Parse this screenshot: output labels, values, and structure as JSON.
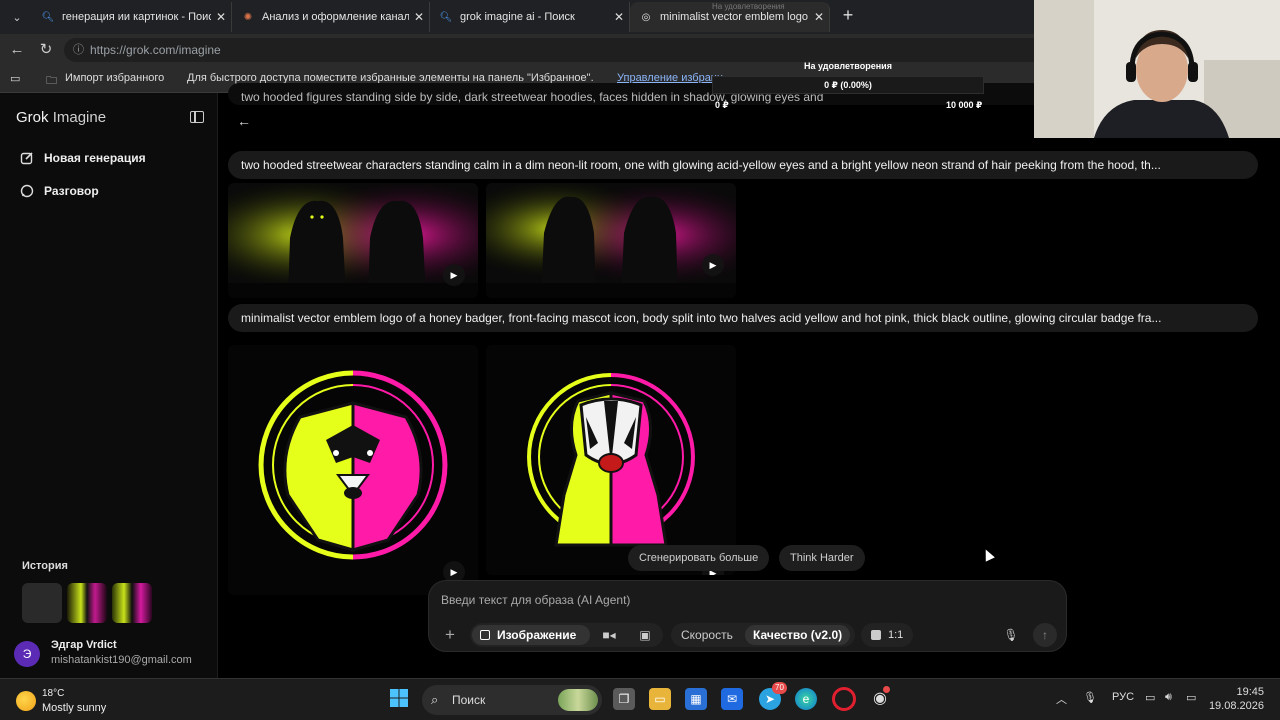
{
  "browser": {
    "tabs": [
      {
        "title": "генерация ии картинок - Поиск",
        "icon": "search-icon"
      },
      {
        "title": "Анализ и оформление канала Ki",
        "icon": "claude-icon"
      },
      {
        "title": "grok imagine ai - Поиск",
        "icon": "search-icon"
      },
      {
        "title": "minimalist vector emblem logo of",
        "icon": "grok-icon"
      }
    ],
    "url": "https://grok.com/imagine",
    "favorites": {
      "import": "Импорт избранного",
      "hint": "Для быстрого доступа поместите избранные элементы на панель \"Избранное\".",
      "manage": "Управление избранн"
    }
  },
  "sidebar": {
    "brand_bold": "Grok",
    "brand_light": "Imagine",
    "items": [
      {
        "label": "Новая генерация",
        "icon": "edit-icon"
      },
      {
        "label": "Разговор",
        "icon": "chat-icon"
      }
    ],
    "history_title": "История",
    "user": {
      "initial": "Э",
      "name": "Эдгар Vrdict",
      "email": "mishatankist190@gmail.com"
    }
  },
  "main": {
    "cut_prompt": "two hooded figures standing side by side, dark streetwear hoodies, faces hidden in shadow, glowing eyes and",
    "prompts": [
      {
        "text": "two hooded streetwear characters standing calm in a dim neon-lit room, one with glowing acid-yellow eyes and a bright yellow neon strand of hair peeking from the hood, th..."
      },
      {
        "text": "minimalist vector emblem logo of a honey badger, front-facing mascot icon, body split into two halves acid yellow and hot pink, thick black outline, glowing circular badge fra..."
      }
    ],
    "actions": {
      "more": "Сгенерировать больше",
      "think": "Think Harder"
    },
    "composer": {
      "placeholder": "Введи текст для образа (AI Agent)",
      "image_label": "Изображение",
      "speed_label": "Скорость",
      "quality_label": "Качество (v2.0)",
      "ratio_label": "1:1"
    }
  },
  "overlay": {
    "title": "На удовлетворения",
    "title_small": "На удовлетворения",
    "value": "0 ₽ (0.00%)",
    "min": "0 ₽",
    "max": "10 000 ₽",
    "progress": 0
  },
  "taskbar": {
    "temp": "18°C",
    "weather": "Mostly sunny",
    "search": "Поиск",
    "telegram_badge": "70",
    "lang": "РУС",
    "time": "19:45",
    "date": "19.08.2026"
  },
  "colors": {
    "acid_yellow": "#e6ff1a",
    "hot_pink": "#ff1aa8",
    "avatar": "#5b2bb5"
  }
}
